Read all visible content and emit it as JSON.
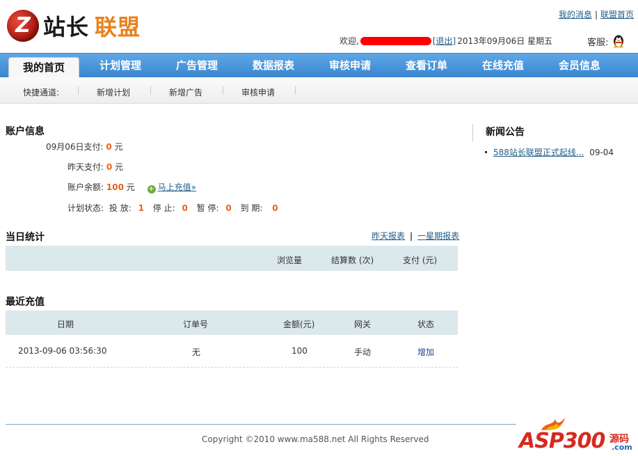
{
  "header": {
    "logo_text_black": "站长",
    "logo_text_orange": "联盟",
    "logo_mark": "Z",
    "links": [
      "我的消息",
      "联盟首页"
    ],
    "link_separator": "|",
    "welcome_prefix": "欢迎,",
    "logout_label": "[退出]",
    "date_text": "2013年09月06日 星期五",
    "service_label": "客服:",
    "service_icon": "qq-penguin-icon"
  },
  "nav": {
    "items": [
      "我的首页",
      "计划管理",
      "广告管理",
      "数据报表",
      "审核申请",
      "查看订单",
      "在线充值",
      "会员信息"
    ],
    "active_index": 0
  },
  "subnav": {
    "label": "快捷通道:",
    "items": [
      "新增计划",
      "新增广告",
      "审核申请"
    ]
  },
  "account": {
    "title": "账户信息",
    "today_label": "09月06日支付:",
    "today_value": "0",
    "yesterday_label": "昨天支付:",
    "yesterday_value": "0",
    "balance_label": "账户余额:",
    "balance_value": "100",
    "unit": "元",
    "recharge_link": "马上充值»",
    "plan_label": "计划状态:",
    "plan_running_label": "投 放:",
    "plan_running": "1",
    "plan_stopped_label": "停 止:",
    "plan_stopped": "0",
    "plan_paused_label": "暂 停:",
    "plan_paused": "0",
    "plan_expired_label": "到 期:",
    "plan_expired": "0"
  },
  "daily": {
    "title": "当日统计",
    "yesterday_report": "昨天报表",
    "week_report": "一星期报表",
    "separator": "|",
    "columns": [
      "浏览量",
      "结算数 (次)",
      "支付 (元)"
    ]
  },
  "recharge": {
    "title": "最近充值",
    "columns": [
      "日期",
      "订单号",
      "金额(元)",
      "网关",
      "状态"
    ],
    "rows": [
      {
        "date": "2013-09-06 03:56:30",
        "order": "无",
        "amount": "100",
        "gateway": "手动",
        "status": "增加"
      }
    ]
  },
  "news": {
    "title": "新闻公告",
    "items": [
      {
        "title": "588站长联盟正式起线...",
        "date": "09-04"
      }
    ]
  },
  "footer": {
    "copyright": "Copyright ©2010 www.ma588.net All Rights Reserved",
    "watermark_main": "ASP300",
    "watermark_sub": "源码",
    "watermark_com": ".com"
  },
  "colors": {
    "nav_blue": "#3a86cf",
    "accent_orange": "#e8611a",
    "link_blue": "#1f5d8a",
    "table_head_bg": "#dbe8ec"
  }
}
